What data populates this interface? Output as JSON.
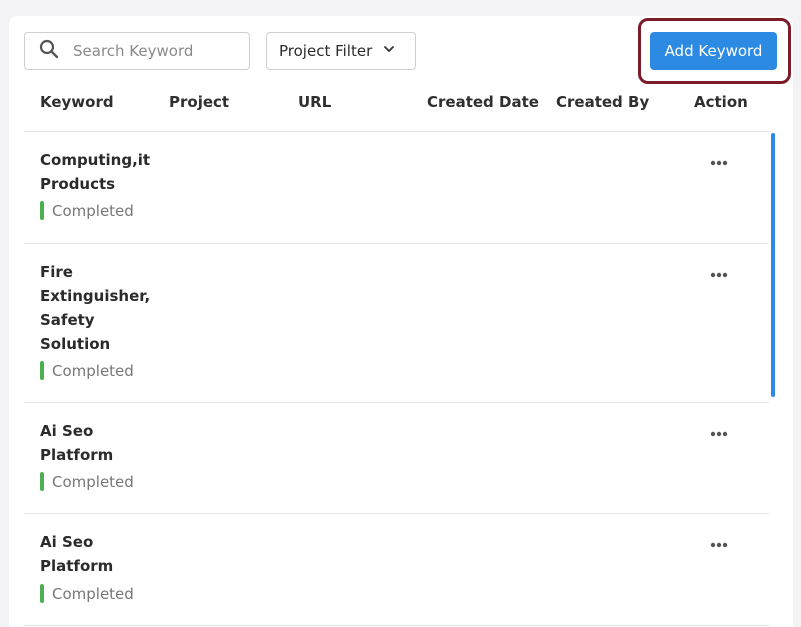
{
  "search": {
    "placeholder": "Search Keyword"
  },
  "filter": {
    "label": "Project Filter"
  },
  "add_button": {
    "label": "Add Keyword"
  },
  "columns": [
    "Keyword",
    "Project",
    "URL",
    "Created Date",
    "Created By",
    "Action"
  ],
  "rows": [
    {
      "keyword_lines": [
        "Computing,it",
        "Products"
      ],
      "status": "Completed"
    },
    {
      "keyword_lines": [
        "Fire",
        "Extinguisher,",
        "Safety",
        "Solution"
      ],
      "status": "Completed"
    },
    {
      "keyword_lines": [
        "Ai Seo",
        "Platform"
      ],
      "status": "Completed"
    },
    {
      "keyword_lines": [
        "Ai Seo",
        "Platform"
      ],
      "status": "Completed"
    }
  ],
  "colors": {
    "accent": "#2d8ae2",
    "highlight": "#7a1c2a",
    "status_completed": "#4cb050"
  }
}
